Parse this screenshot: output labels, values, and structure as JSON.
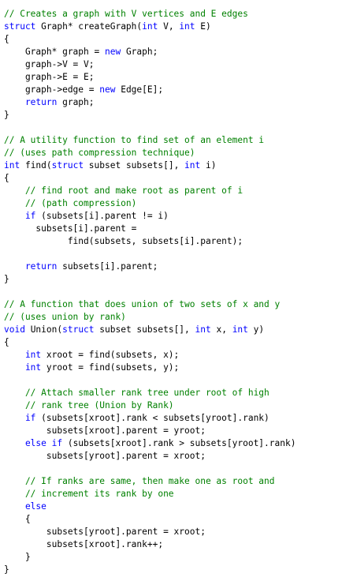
{
  "theme": {
    "background": "#ffffff",
    "plain": "#000000",
    "keyword": "#0000ff",
    "comment": "#008000"
  },
  "code": {
    "lines": [
      [
        [
          "comment",
          "// Creates a graph with V vertices and E edges"
        ]
      ],
      [
        [
          "keyword",
          "struct"
        ],
        [
          "plain",
          " Graph* createGraph("
        ],
        [
          "keyword",
          "int"
        ],
        [
          "plain",
          " V, "
        ],
        [
          "keyword",
          "int"
        ],
        [
          "plain",
          " E)"
        ]
      ],
      [
        [
          "plain",
          "{"
        ]
      ],
      [
        [
          "plain",
          "    Graph* graph = "
        ],
        [
          "keyword",
          "new"
        ],
        [
          "plain",
          " Graph;"
        ]
      ],
      [
        [
          "plain",
          "    graph->V = V;"
        ]
      ],
      [
        [
          "plain",
          "    graph->E = E;"
        ]
      ],
      [
        [
          "plain",
          "    graph->edge = "
        ],
        [
          "keyword",
          "new"
        ],
        [
          "plain",
          " Edge[E];"
        ]
      ],
      [
        [
          "keyword",
          "    return"
        ],
        [
          "plain",
          " graph;"
        ]
      ],
      [
        [
          "plain",
          "}"
        ]
      ],
      [],
      [
        [
          "comment",
          "// A utility function to find set of an element i"
        ]
      ],
      [
        [
          "comment",
          "// (uses path compression technique)"
        ]
      ],
      [
        [
          "keyword",
          "int"
        ],
        [
          "plain",
          " find("
        ],
        [
          "keyword",
          "struct"
        ],
        [
          "plain",
          " subset subsets[], "
        ],
        [
          "keyword",
          "int"
        ],
        [
          "plain",
          " i)"
        ]
      ],
      [
        [
          "plain",
          "{"
        ]
      ],
      [
        [
          "comment",
          "    // find root and make root as parent of i"
        ]
      ],
      [
        [
          "comment",
          "    // (path compression)"
        ]
      ],
      [
        [
          "keyword",
          "    if"
        ],
        [
          "plain",
          " (subsets[i].parent != i)"
        ]
      ],
      [
        [
          "plain",
          "      subsets[i].parent ="
        ]
      ],
      [
        [
          "plain",
          "            find(subsets, subsets[i].parent);"
        ]
      ],
      [],
      [
        [
          "keyword",
          "    return"
        ],
        [
          "plain",
          " subsets[i].parent;"
        ]
      ],
      [
        [
          "plain",
          "}"
        ]
      ],
      [],
      [
        [
          "comment",
          "// A function that does union of two sets of x and y"
        ]
      ],
      [
        [
          "comment",
          "// (uses union by rank)"
        ]
      ],
      [
        [
          "keyword",
          "void"
        ],
        [
          "plain",
          " Union("
        ],
        [
          "keyword",
          "struct"
        ],
        [
          "plain",
          " subset subsets[], "
        ],
        [
          "keyword",
          "int"
        ],
        [
          "plain",
          " x, "
        ],
        [
          "keyword",
          "int"
        ],
        [
          "plain",
          " y)"
        ]
      ],
      [
        [
          "plain",
          "{"
        ]
      ],
      [
        [
          "keyword",
          "    int"
        ],
        [
          "plain",
          " xroot = find(subsets, x);"
        ]
      ],
      [
        [
          "keyword",
          "    int"
        ],
        [
          "plain",
          " yroot = find(subsets, y);"
        ]
      ],
      [],
      [
        [
          "comment",
          "    // Attach smaller rank tree under root of high"
        ]
      ],
      [
        [
          "comment",
          "    // rank tree (Union by Rank)"
        ]
      ],
      [
        [
          "keyword",
          "    if"
        ],
        [
          "plain",
          " (subsets[xroot].rank < subsets[yroot].rank)"
        ]
      ],
      [
        [
          "plain",
          "        subsets[xroot].parent = yroot;"
        ]
      ],
      [
        [
          "keyword",
          "    else if"
        ],
        [
          "plain",
          " (subsets[xroot].rank > subsets[yroot].rank)"
        ]
      ],
      [
        [
          "plain",
          "        subsets[yroot].parent = xroot;"
        ]
      ],
      [],
      [
        [
          "comment",
          "    // If ranks are same, then make one as root and"
        ]
      ],
      [
        [
          "comment",
          "    // increment its rank by one"
        ]
      ],
      [
        [
          "keyword",
          "    else"
        ]
      ],
      [
        [
          "plain",
          "    {"
        ]
      ],
      [
        [
          "plain",
          "        subsets[yroot].parent = xroot;"
        ]
      ],
      [
        [
          "plain",
          "        subsets[xroot].rank++;"
        ]
      ],
      [
        [
          "plain",
          "    }"
        ]
      ],
      [
        [
          "plain",
          "}"
        ]
      ]
    ]
  }
}
